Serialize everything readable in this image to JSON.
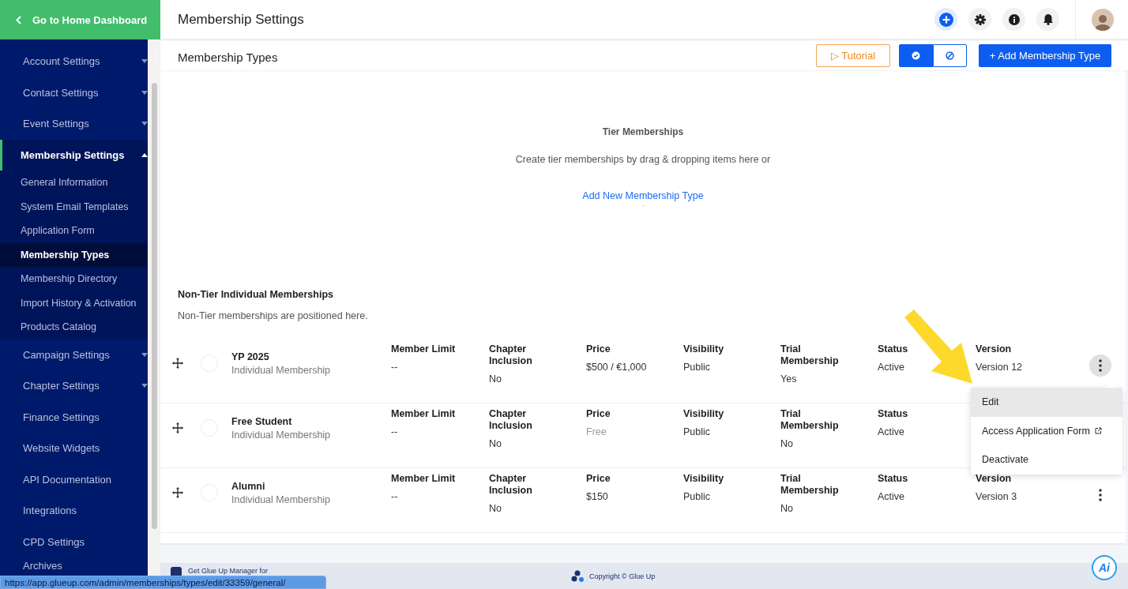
{
  "sidebar": {
    "home_link": "Go to Home Dashboard",
    "items": [
      {
        "label": "Account Settings",
        "kind": "group",
        "expanded": false,
        "selected": false
      },
      {
        "label": "Contact Settings",
        "kind": "group",
        "expanded": false,
        "selected": false
      },
      {
        "label": "Event Settings",
        "kind": "group",
        "expanded": false,
        "selected": false
      },
      {
        "label": "Membership Settings",
        "kind": "group",
        "expanded": true,
        "selected": true,
        "children": [
          {
            "label": "General Information",
            "selected": false
          },
          {
            "label": "System Email Templates",
            "selected": false
          },
          {
            "label": "Application Form",
            "selected": false
          },
          {
            "label": "Membership Types",
            "selected": true
          },
          {
            "label": "Membership Directory",
            "selected": false
          },
          {
            "label": "Import History & Activation",
            "selected": false
          },
          {
            "label": "Products Catalog",
            "selected": false
          }
        ]
      },
      {
        "label": "Campaign Settings",
        "kind": "group",
        "expanded": false,
        "selected": false
      },
      {
        "label": "Chapter Settings",
        "kind": "group",
        "expanded": false,
        "selected": false
      },
      {
        "label": "Finance Settings",
        "kind": "link",
        "selected": false
      },
      {
        "label": "Website Widgets",
        "kind": "link",
        "selected": false
      },
      {
        "label": "API Documentation",
        "kind": "link",
        "selected": false
      },
      {
        "label": "Integrations",
        "kind": "link",
        "selected": false
      },
      {
        "label": "CPD Settings",
        "kind": "link",
        "selected": false
      },
      {
        "label": "Archives",
        "kind": "link",
        "selected": false
      }
    ]
  },
  "top_bar": {
    "title": "Membership Settings"
  },
  "section_header": {
    "title": "Membership Types",
    "tutorial": "▷ Tutorial",
    "view_toggle": [
      {
        "kind": "badge",
        "selected": true
      },
      {
        "kind": "blocked",
        "selected": false
      }
    ],
    "add_button": "+ Add Membership Type"
  },
  "tier_section": {
    "title": "Tier Memberships",
    "hint": "Create tier memberships by drag & dropping items here or",
    "link": "Add New Membership Type",
    "note": "."
  },
  "non_tier_section": {
    "title": "Non-Tier Individual Memberships",
    "subtitle": "Non-Tier memberships are positioned here.",
    "rows": [
      {
        "name": "YP 2025",
        "type": "Individual Membership",
        "selected": false,
        "menu_open": true,
        "columns": [
          {
            "label": "Member Limit",
            "value": "--"
          },
          {
            "label": "Chapter Inclusion",
            "value": "No"
          },
          {
            "label": "Price",
            "value": "$500 / €1,000",
            "muted": false
          },
          {
            "label": "Visibility",
            "value": "Public"
          },
          {
            "label": "Trial Membership",
            "value": "Yes"
          },
          {
            "label": "Status",
            "value": "Active"
          },
          {
            "label": "Version",
            "value": "Version 12"
          }
        ]
      },
      {
        "name": "Free Student",
        "type": "Individual Membership",
        "selected": false,
        "columns": [
          {
            "label": "Member Limit",
            "value": "--"
          },
          {
            "label": "Chapter Inclusion",
            "value": "No"
          },
          {
            "label": "Price",
            "value": "Free",
            "muted": true
          },
          {
            "label": "Visibility",
            "value": "Public"
          },
          {
            "label": "Trial Membership",
            "value": "No"
          },
          {
            "label": "Status",
            "value": "Active"
          }
        ]
      },
      {
        "name": "Alumni",
        "type": "Individual Membership",
        "selected": false,
        "menu_open": false,
        "columns": [
          {
            "label": "Member Limit",
            "value": "--"
          },
          {
            "label": "Chapter Inclusion",
            "value": "No"
          },
          {
            "label": "Price",
            "value": "$150",
            "muted": false
          },
          {
            "label": "Visibility",
            "value": "Public"
          },
          {
            "label": "Trial Membership",
            "value": "No"
          },
          {
            "label": "Status",
            "value": "Active"
          },
          {
            "label": "Version",
            "value": "Version 3"
          }
        ]
      }
    ]
  },
  "action_menu": {
    "items": [
      {
        "label": "Edit",
        "kind": "plain",
        "selected": true
      },
      {
        "label": "Access Application Form",
        "kind": "external",
        "selected": false
      },
      {
        "label": "Deactivate",
        "kind": "plain",
        "selected": false
      }
    ]
  },
  "footer": {
    "app_promo": "Get Glue Up Manager for",
    "copyright": "Copyright © Glue Up",
    "assistant": "Ai"
  },
  "status_url": "https://app.glueup.com/admin/memberships/types/edit/33359/general/"
}
